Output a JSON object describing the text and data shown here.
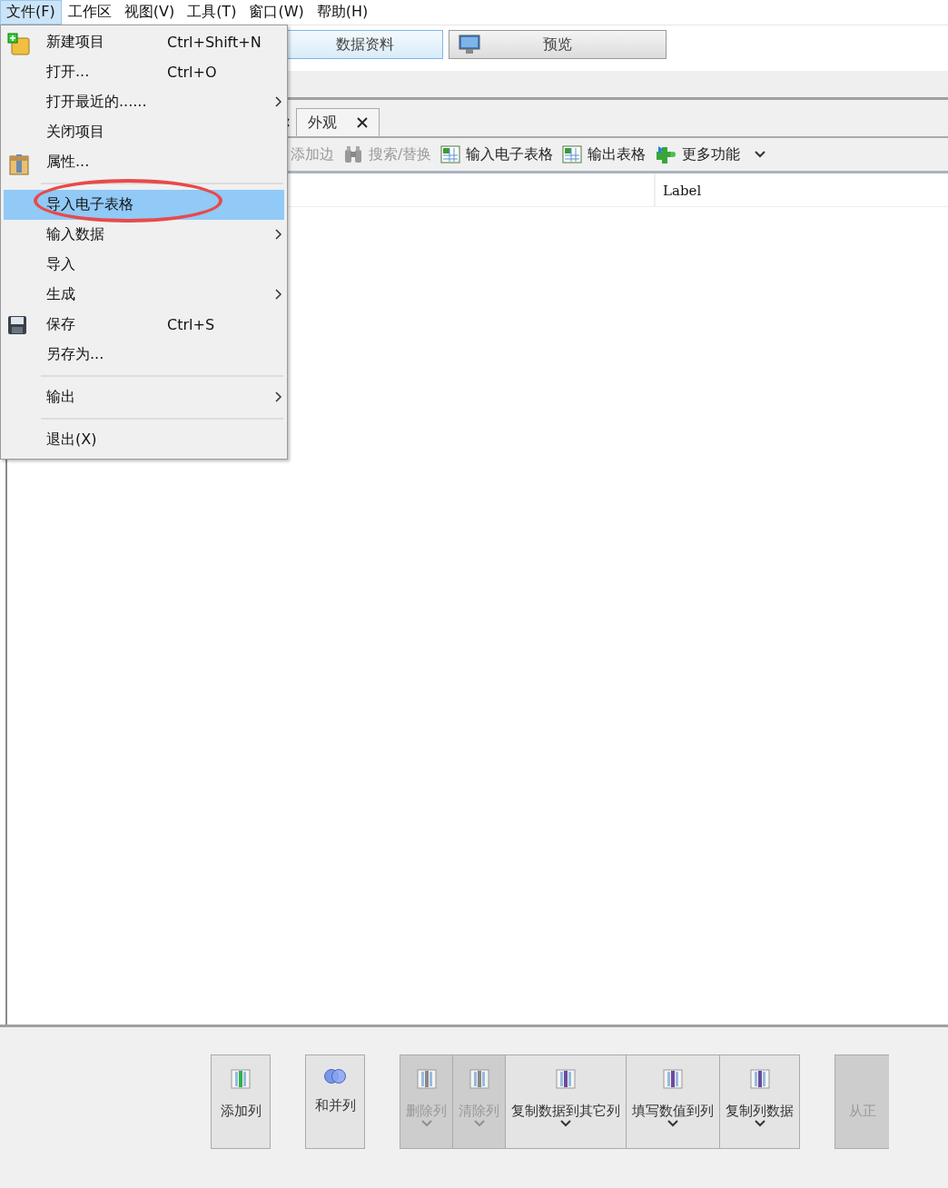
{
  "menubar": [
    {
      "label": "文件(F)",
      "selected": true
    },
    {
      "label": "工作区",
      "selected": false
    },
    {
      "label": "视图(V)",
      "selected": false
    },
    {
      "label": "工具(T)",
      "selected": false
    },
    {
      "label": "窗口(W)",
      "selected": false
    },
    {
      "label": "帮助(H)",
      "selected": false
    }
  ],
  "file_menu": [
    {
      "kind": "item",
      "label": "新建项目",
      "shortcut": "Ctrl+Shift+N",
      "submenu": false,
      "selected": false,
      "circled": false
    },
    {
      "kind": "item",
      "label": "打开...",
      "shortcut": "Ctrl+O",
      "submenu": false,
      "selected": false,
      "circled": false
    },
    {
      "kind": "item",
      "label": "打开最近的......",
      "submenu": true,
      "selected": false,
      "circled": false
    },
    {
      "kind": "item",
      "label": "关闭项目",
      "submenu": false,
      "selected": false,
      "circled": false
    },
    {
      "kind": "item",
      "label": "属性...",
      "submenu": false,
      "selected": false,
      "circled": false
    },
    {
      "kind": "separator"
    },
    {
      "kind": "item",
      "label": "导入电子表格",
      "submenu": false,
      "selected": true,
      "circled": true
    },
    {
      "kind": "item",
      "label": "输入数据",
      "submenu": true,
      "selected": false,
      "circled": false
    },
    {
      "kind": "item",
      "label": "导入",
      "submenu": false,
      "selected": false,
      "circled": false
    },
    {
      "kind": "item",
      "label": "生成",
      "submenu": true,
      "selected": false,
      "circled": false
    },
    {
      "kind": "item",
      "label": "保存",
      "shortcut": "Ctrl+S",
      "submenu": false,
      "selected": false,
      "circled": false
    },
    {
      "kind": "item",
      "label": "另存为...",
      "submenu": false,
      "selected": false,
      "circled": false
    },
    {
      "kind": "separator"
    },
    {
      "kind": "item",
      "label": "输出",
      "submenu": true,
      "selected": false,
      "circled": false
    },
    {
      "kind": "separator"
    },
    {
      "kind": "item",
      "label": "退出(X)",
      "submenu": false,
      "selected": false,
      "circled": false
    }
  ],
  "view_buttons": [
    {
      "label": "数据资料",
      "selected": true
    },
    {
      "label": "预览",
      "selected": false
    }
  ],
  "tabs": [
    {
      "label": "外观"
    }
  ],
  "table_toolbar": [
    {
      "label": "添加边",
      "disabled": true
    },
    {
      "label": "搜索/替换",
      "disabled": true
    },
    {
      "label": "输入电子表格",
      "disabled": false
    },
    {
      "label": "输出表格",
      "disabled": false
    },
    {
      "label": "更多功能",
      "disabled": false
    }
  ],
  "table": {
    "columns": [
      "Label"
    ]
  },
  "column_buttons": [
    {
      "label": "添加列",
      "disabled": false,
      "dropdown": false,
      "grouped": false
    },
    {
      "label": "和并列",
      "disabled": false,
      "dropdown": false,
      "grouped": false
    },
    {
      "label": "删除列",
      "disabled": true,
      "dropdown": true,
      "grouped": true
    },
    {
      "label": "清除列",
      "disabled": true,
      "dropdown": true,
      "grouped": true
    },
    {
      "label": "复制数据到其它列",
      "disabled": false,
      "dropdown": true,
      "grouped": true
    },
    {
      "label": "填写数值到列",
      "disabled": false,
      "dropdown": true,
      "grouped": true
    },
    {
      "label": "复制列数据",
      "disabled": false,
      "dropdown": true,
      "grouped": true
    },
    {
      "label": "从正",
      "disabled": true,
      "dropdown": false,
      "grouped": false
    }
  ]
}
